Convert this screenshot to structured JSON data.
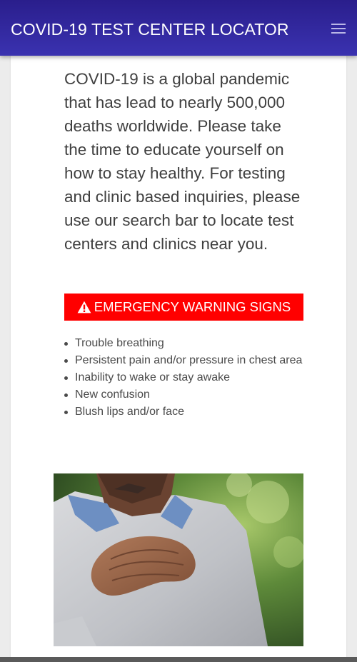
{
  "navbar": {
    "title": "COVID-19 TEST CENTER LOCATOR",
    "menu_icon": "hamburger-menu-icon"
  },
  "main": {
    "intro_text": "COVID-19 is a global pandemic that has lead to nearly 500,000 deaths worldwide. Please take the time to educate yourself on how to stay healthy. For testing and clinic based inquiries, please use our search bar to locate test centers and clinics near you.",
    "warning_button": {
      "label": "EMERGENCY WARNING SIGNS",
      "icon": "warning-triangle-icon",
      "color": "#ff0000"
    },
    "warning_signs": [
      "Trouble breathing",
      "Persistent pain and/or pressure in chest area",
      "Inability to wake or stay awake",
      "New confusion",
      "Blush lips and/or face"
    ]
  },
  "colors": {
    "navbar": "#2f259e",
    "warning": "#ff0000",
    "body_text": "#3f3f3f"
  }
}
